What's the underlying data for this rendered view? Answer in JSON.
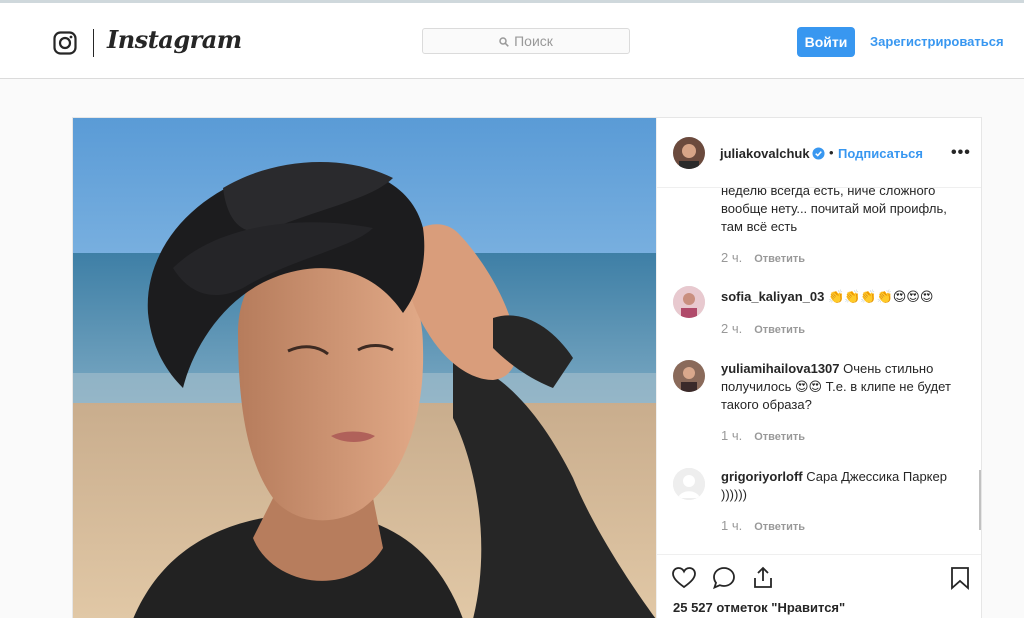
{
  "header": {
    "brand": "Instagram",
    "search_placeholder": "Поиск",
    "login_label": "Войти",
    "register_label": "Зарегистрироваться"
  },
  "post": {
    "username": "juliakovalchuk",
    "separator": "•",
    "follow_label": "Подписаться",
    "more_label": "•••",
    "likes_text": "25 527 отметок \"Нравится\""
  },
  "comments": [
    {
      "username": "",
      "text": "неделю всегда есть, ниче сложного вообще нету... почитай мой проифль, там всё есть",
      "time": "2 ч.",
      "reply": "Ответить"
    },
    {
      "username": "sofia_kaliyan_03",
      "text": "👏👏👏👏😍😍😍",
      "time": "2 ч.",
      "reply": "Ответить"
    },
    {
      "username": "yuliamihailova1307",
      "text": "Очень стильно получилось 😍😍 Т.е. в клипе не будет такого образа?",
      "time": "1 ч.",
      "reply": "Ответить"
    },
    {
      "username": "grigoriyorloff",
      "text": "Сара Джессика Паркер ))))))",
      "time": "1 ч.",
      "reply": "Ответить"
    }
  ],
  "icons": {
    "logo": "instagram-camera-icon",
    "search": "search-icon",
    "verified": "verified-badge-icon",
    "like": "heart-icon",
    "comment": "comment-icon",
    "share": "share-icon",
    "save": "bookmark-icon"
  },
  "colors": {
    "accent": "#3897f0",
    "text": "#262626",
    "muted": "#999999"
  }
}
